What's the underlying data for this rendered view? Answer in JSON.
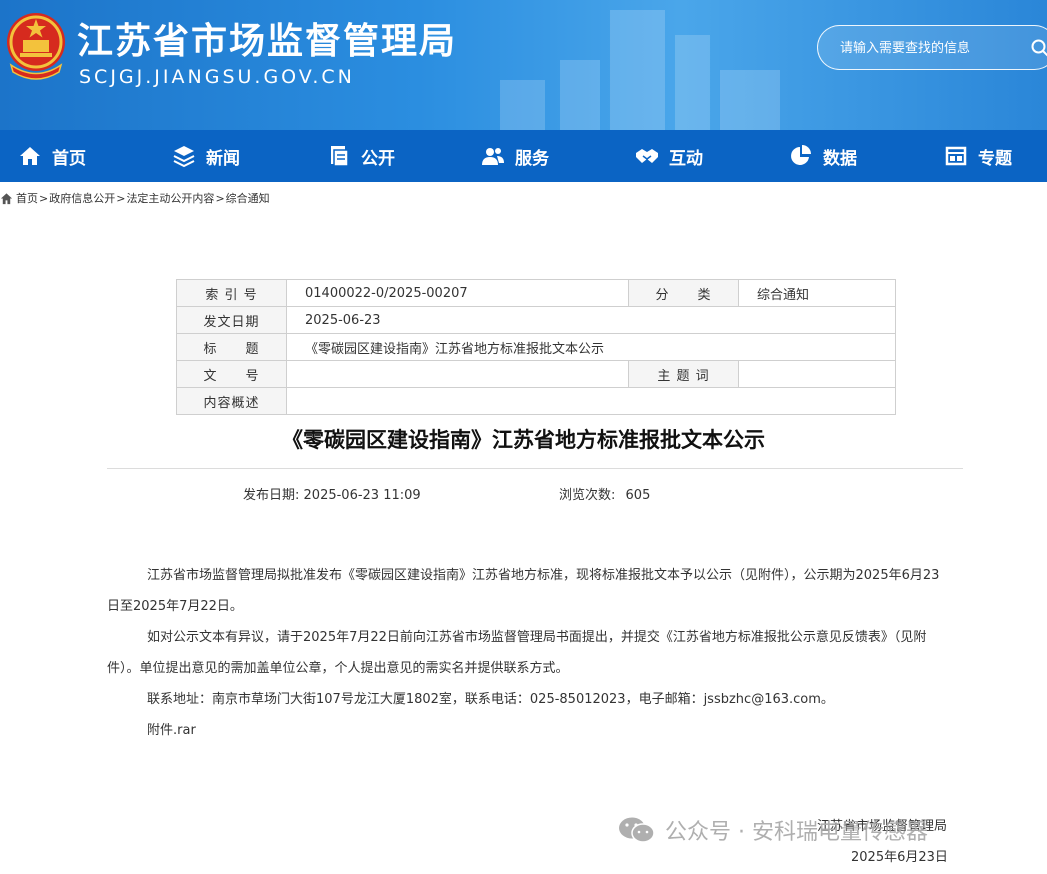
{
  "header": {
    "site_title": "江苏省市场监督管理局",
    "site_domain": "SCJGJ.JIANGSU.GOV.CN",
    "search_placeholder": "请输入需要查找的信息"
  },
  "nav": {
    "items": [
      {
        "label": "首页",
        "icon": "home-icon"
      },
      {
        "label": "新闻",
        "icon": "layers-icon"
      },
      {
        "label": "公开",
        "icon": "documents-icon"
      },
      {
        "label": "服务",
        "icon": "people-icon"
      },
      {
        "label": "互动",
        "icon": "handshake-icon"
      },
      {
        "label": "数据",
        "icon": "pie-chart-icon"
      },
      {
        "label": "专题",
        "icon": "grid-window-icon"
      }
    ]
  },
  "breadcrumb": {
    "items": [
      "首页",
      "政府信息公开",
      "法定主动公开内容",
      "综合通知"
    ],
    "separator": ">"
  },
  "info_table": {
    "index_label": "索 引 号",
    "index_value": "01400022-0/2025-00207",
    "category_label": "分　　类",
    "category_value": "综合通知",
    "date_label": "发文日期",
    "date_value": "2025-06-23",
    "title_label": "标　　题",
    "title_value": "《零碳园区建设指南》江苏省地方标准报批文本公示",
    "doc_no_label": "文　　号",
    "doc_no_value": "",
    "keywords_label": "主 题 词",
    "keywords_value": "",
    "summary_label": "内容概述",
    "summary_value": ""
  },
  "article": {
    "title": "《零碳园区建设指南》江苏省地方标准报批文本公示",
    "publish_label": "发布日期:",
    "publish_value": "2025-06-23 11:09",
    "views_label": "浏览次数:",
    "views_value": "605",
    "paragraphs": [
      "江苏省市场监督管理局拟批准发布《零碳园区建设指南》江苏省地方标准，现将标准报批文本予以公示（见附件），公示期为2025年6月23日至2025年7月22日。",
      "如对公示文本有异议，请于2025年7月22日前向江苏省市场监督管理局书面提出，并提交《江苏省地方标准报批公示意见反馈表》（见附件）。单位提出意见的需加盖单位公章，个人提出意见的需实名并提供联系方式。",
      "联系地址：南京市草场门大街107号龙江大厦1802室，联系电话：025-85012023，电子邮箱：jssbzhc@163.com。",
      "附件.rar"
    ],
    "signature_org": "江苏省市场监督管理局",
    "signature_date": "2025年6月23日"
  },
  "watermark": {
    "text": "公众号 · 安科瑞电量传感器"
  },
  "colors": {
    "header_blue": "#1c74c9",
    "nav_blue": "#0b64c4",
    "table_label_bg": "#f5f5f5"
  }
}
